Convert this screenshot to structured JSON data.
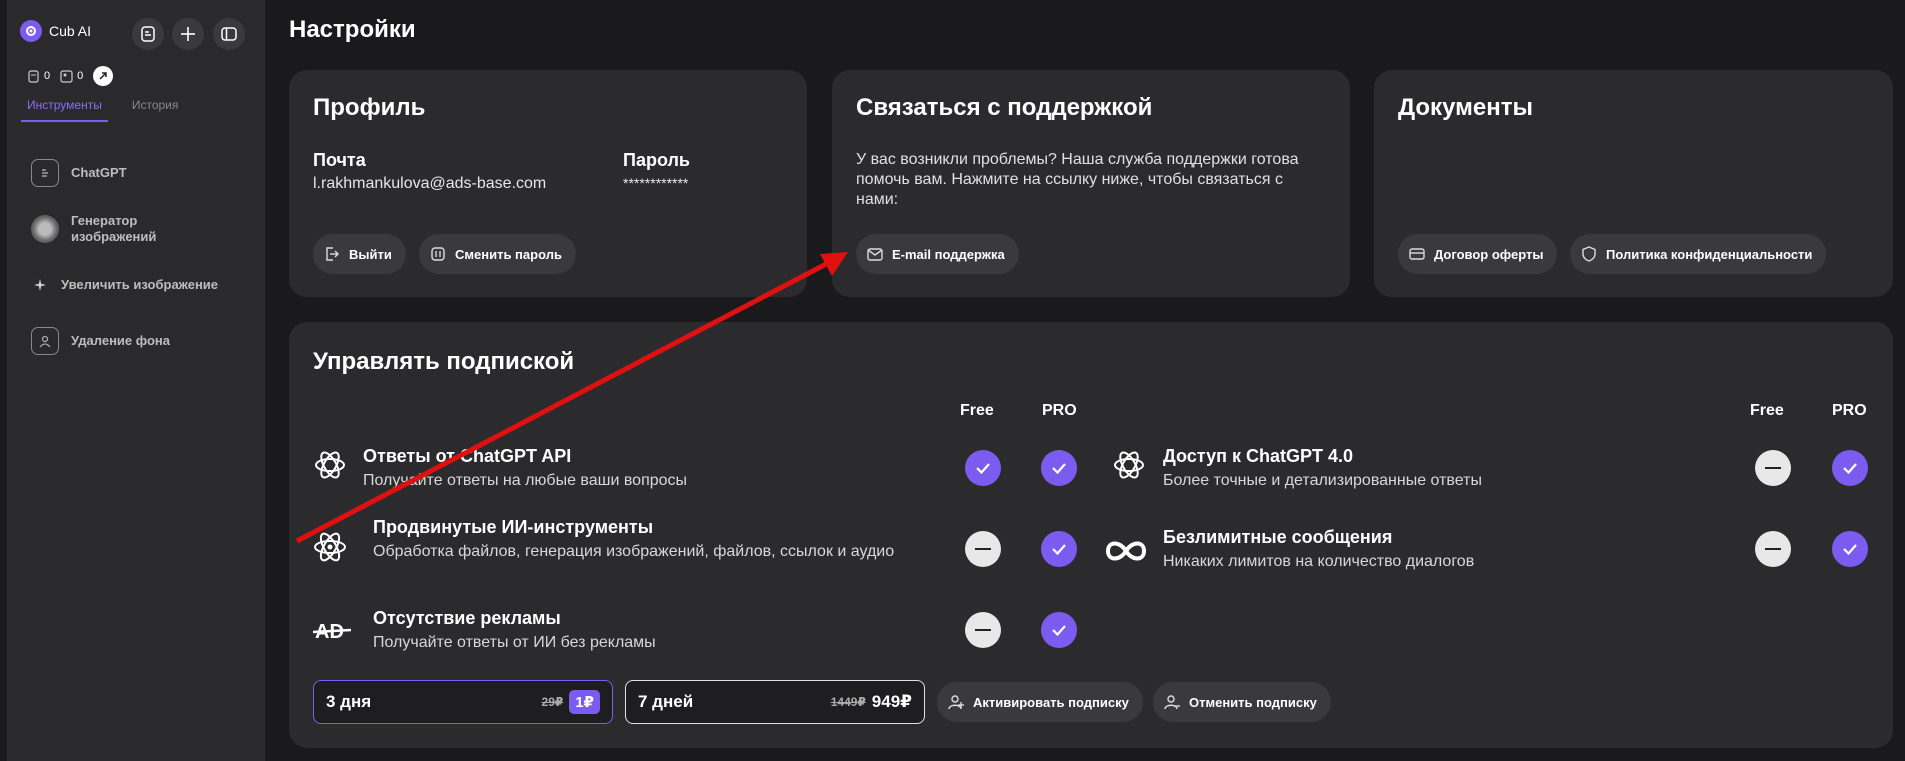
{
  "app": {
    "name": "Cub AI"
  },
  "sidebar": {
    "counters": [
      {
        "value": "0",
        "icon": "document-icon"
      },
      {
        "value": "0",
        "icon": "image-icon"
      }
    ],
    "tabs": [
      {
        "label": "Инструменты",
        "active": true
      },
      {
        "label": "История",
        "active": false
      }
    ],
    "items": [
      {
        "label": "ChatGPT",
        "icon": "chat-doc-icon"
      },
      {
        "label": "Генератор изображений",
        "icon": "generator-icon"
      },
      {
        "label": "Увеличить изображение",
        "icon": "sparkle-icon"
      },
      {
        "label": "Удаление фона",
        "icon": "background-remove-icon"
      }
    ]
  },
  "page": {
    "title": "Настройки"
  },
  "profile": {
    "title": "Профиль",
    "email_label": "Почта",
    "email_value": "l.rakhmankulova@ads-base.com",
    "password_label": "Пароль",
    "password_value": "************",
    "logout_label": "Выйти",
    "change_password_label": "Сменить пароль"
  },
  "support": {
    "title": "Связаться с поддержкой",
    "text": "У вас возникли проблемы? Наша служба поддержки готова помочь вам. Нажмите на ссылку ниже, чтобы связаться с нами:",
    "email_button": "E-mail поддержка"
  },
  "documents": {
    "title": "Документы",
    "offer_label": "Договор оферты",
    "privacy_label": "Политика конфиденциальности"
  },
  "subscription": {
    "title": "Управлять подпиской",
    "col_free": "Free",
    "col_pro": "PRO",
    "features_left": [
      {
        "title": "Ответы от ChatGPT API",
        "subtitle": "Получайте ответы на любые ваши вопросы",
        "free": true,
        "pro": true
      },
      {
        "title": "Продвинутые ИИ-инструменты",
        "subtitle": "Обработка файлов, генерация изображений, файлов, ссылок и аудио",
        "free": false,
        "pro": true
      },
      {
        "title": "Отсутствие рекламы",
        "subtitle": "Получайте ответы от ИИ без рекламы",
        "free": false,
        "pro": true
      }
    ],
    "features_right": [
      {
        "title": "Доступ к ChatGPT 4.0",
        "subtitle": "Более точные и детализированные ответы",
        "free": false,
        "pro": true
      },
      {
        "title": "Безлимитные сообщения",
        "subtitle": "Никаких лимитов на количество диалогов",
        "free": false,
        "pro": true
      }
    ],
    "plans": [
      {
        "name": "3 дня",
        "old_price": "29₽",
        "price": "1₽",
        "selected": true
      },
      {
        "name": "7 дней",
        "old_price": "1449₽",
        "price": "949₽",
        "selected": false
      }
    ],
    "activate_label": "Активировать подписку",
    "cancel_label": "Отменить подписку"
  },
  "colors": {
    "accent": "#7c5cf0",
    "card": "#2b2b2d",
    "background": "#1a1a1c",
    "annotation_arrow": "#e01010"
  }
}
